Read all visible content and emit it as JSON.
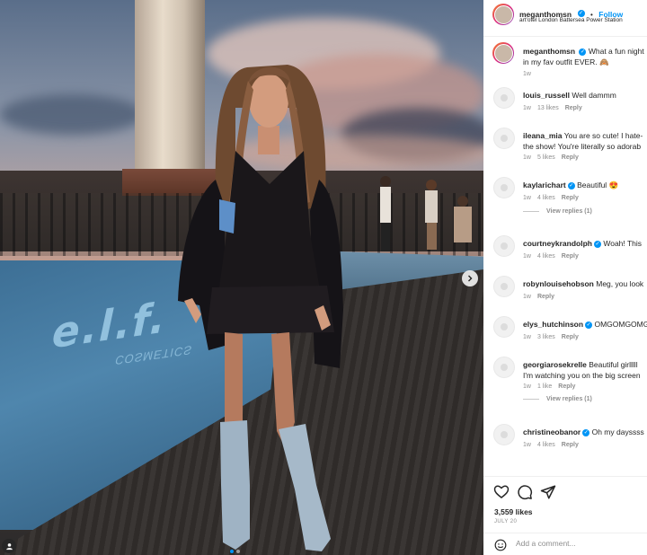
{
  "post": {
    "author": "meganthomsn",
    "follow_label": "Follow",
    "separator": "•",
    "location": "art'otel London Battersea Power Station",
    "pool_logo_text": "e.l.f.",
    "pool_logo_sub": "COSMETICS"
  },
  "caption": {
    "username": "meganthomsn",
    "text": "What a fun night in my fav outfit EVER",
    "line2": "in my fav outfit EVER. 🙈",
    "line1": "What a fun night",
    "time": "1w"
  },
  "comments": [
    {
      "username": "louis_russell",
      "verified": false,
      "line1": "Well dammm",
      "line2": "",
      "time": "1w",
      "likes": "13 likes",
      "reply": "Reply",
      "view_replies": ""
    },
    {
      "username": "ileana_mia",
      "verified": false,
      "line1": "You are so cute! I hate-",
      "line2": "the show! You're literally so adorab",
      "time": "1w",
      "likes": "5 likes",
      "reply": "Reply",
      "view_replies": ""
    },
    {
      "username": "kaylarichart",
      "verified": true,
      "line1": "Beautiful 😍",
      "line2": "",
      "time": "1w",
      "likes": "4 likes",
      "reply": "Reply",
      "view_replies": "View replies (1)"
    },
    {
      "username": "courtneykrandolph",
      "verified": true,
      "line1": "Woah! This",
      "line2": "",
      "time": "1w",
      "likes": "4 likes",
      "reply": "Reply",
      "view_replies": ""
    },
    {
      "username": "robynlouisehobson",
      "verified": false,
      "line1": "Meg, you look",
      "line2": "",
      "time": "1w",
      "likes": "",
      "reply": "Reply",
      "view_replies": ""
    },
    {
      "username": "elys_hutchinson",
      "verified": true,
      "line1": "OMGOMGOMG",
      "line2": "",
      "time": "1w",
      "likes": "3 likes",
      "reply": "Reply",
      "view_replies": ""
    },
    {
      "username": "georgiarosekrelle",
      "verified": false,
      "line1": "Beautiful girlllll",
      "line2": "I'm watching you on the big screen",
      "time": "1w",
      "likes": "1 like",
      "reply": "Reply",
      "view_replies": "View replies (1)"
    },
    {
      "username": "christineobanor",
      "verified": true,
      "line1": "Oh my dayssss",
      "line2": "",
      "time": "1w",
      "likes": "4 likes",
      "reply": "Reply",
      "view_replies": ""
    }
  ],
  "footer": {
    "likes": "3,559 likes",
    "date": "JULY 20",
    "add_comment_placeholder": "Add a comment...",
    "icons": [
      "heart-icon",
      "comment-icon",
      "share-icon"
    ]
  },
  "colors": {
    "accent": "#0095f6",
    "like_red": "#ed4956"
  }
}
